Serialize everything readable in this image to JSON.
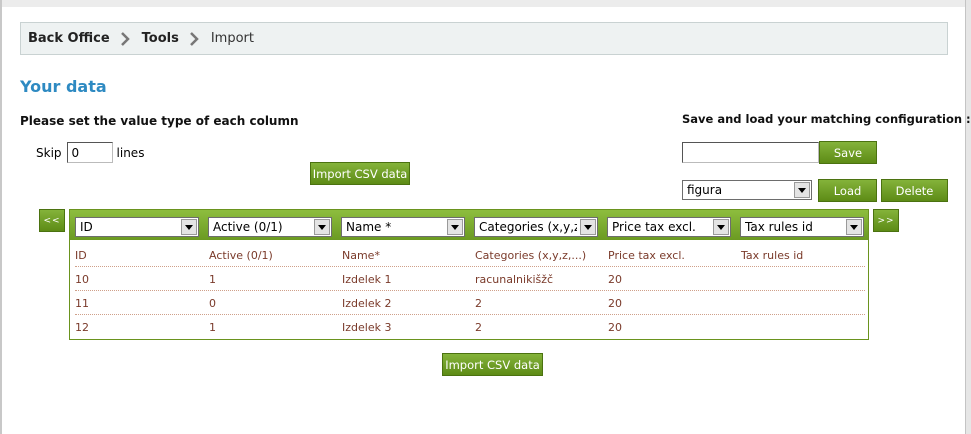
{
  "breadcrumb": {
    "items": [
      "Back Office",
      "Tools",
      "Import"
    ]
  },
  "page_title": "Your data",
  "instructions": "Please set the value type of each column",
  "skip": {
    "label": "Skip",
    "value": "0",
    "suffix": "lines"
  },
  "import_button_label": "Import CSV data",
  "config": {
    "label": "Save and load your matching configuration :",
    "name_value": "",
    "save_label": "Save",
    "selected": "figura",
    "load_label": "Load",
    "delete_label": "Delete"
  },
  "nav": {
    "prev": "<<",
    "next": ">>"
  },
  "columns": [
    {
      "select": "ID",
      "header": "ID"
    },
    {
      "select": "Active (0/1)",
      "header": "Active (0/1)"
    },
    {
      "select": "Name *",
      "header": "Name*"
    },
    {
      "select": "Categories (x,y,z",
      "header": "Categories (x,y,z,...)"
    },
    {
      "select": "Price tax excl.",
      "header": "Price tax excl."
    },
    {
      "select": "Tax rules id",
      "header": "Tax rules id"
    }
  ],
  "rows": [
    [
      "10",
      "1",
      "Izdelek 1",
      "racunalnikišžč",
      "20",
      ""
    ],
    [
      "11",
      "0",
      "Izdelek 2",
      "2",
      "20",
      ""
    ],
    [
      "12",
      "1",
      "Izdelek 3",
      "2",
      "20",
      ""
    ]
  ],
  "colors": {
    "accent": "#2e8ac2",
    "button": "#6b9c1f",
    "cell_text": "#7a3a2a"
  }
}
